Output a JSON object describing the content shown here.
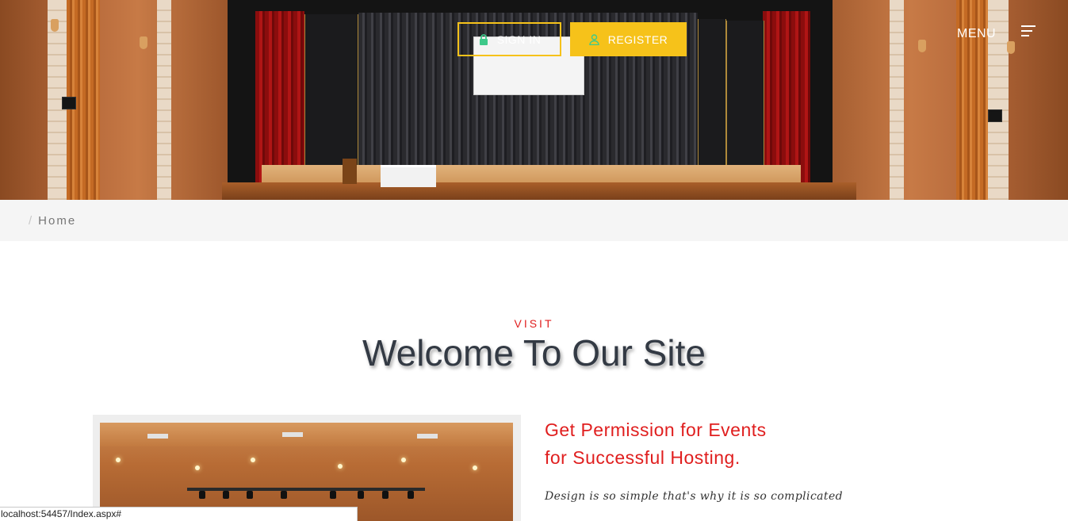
{
  "header": {
    "sign_in_label": "SIGN IN",
    "register_label": "REGISTER",
    "menu_label": "MENU"
  },
  "breadcrumb": {
    "current": "Home"
  },
  "welcome": {
    "kicker": "VISIT",
    "title": "Welcome To Our Site",
    "heading_line1": "Get Permission for Events",
    "heading_line2": "for Successful Hosting.",
    "quote": "Design is so simple that's why it is so complicated"
  },
  "status_bar": {
    "url": "localhost:54457/Index.aspx#"
  },
  "colors": {
    "accent_yellow": "#f6c21a",
    "accent_red": "#e01e1e",
    "title_text": "#333a44",
    "icon_green": "#3ec98a"
  },
  "icons": {
    "sign_in": "lock-icon",
    "register": "user-icon",
    "menu": "hamburger-icon"
  }
}
